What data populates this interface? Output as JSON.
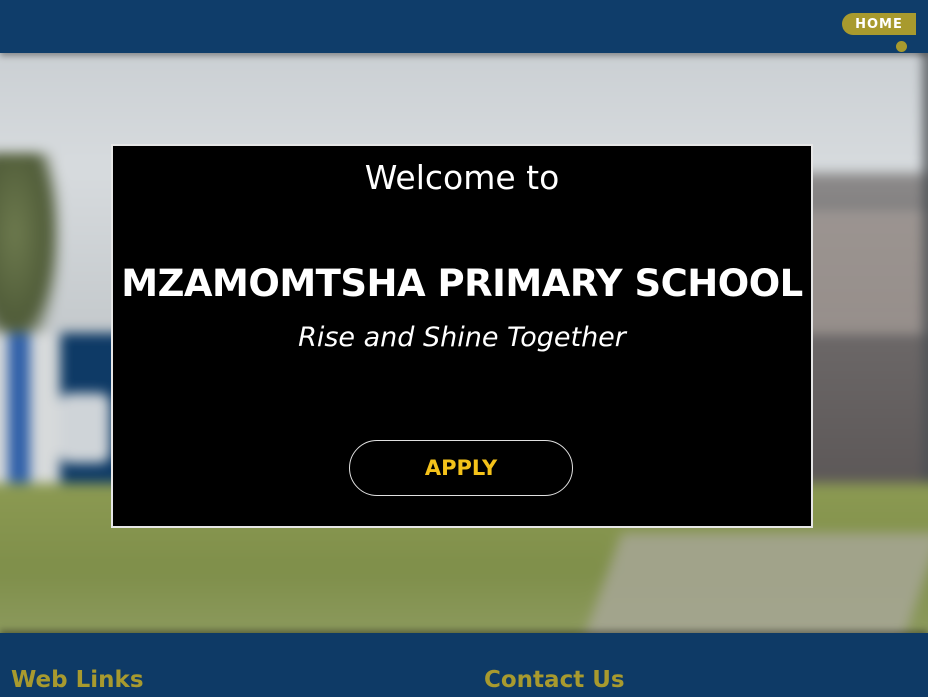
{
  "header": {
    "nav": {
      "home_label": "HOME"
    }
  },
  "hero": {
    "welcome": "Welcome to",
    "school_name": "MZAMOMTSHA PRIMARY SCHOOL",
    "tagline": "Rise and Shine Together",
    "apply_label": "APPLY"
  },
  "footer": {
    "web_links_heading": "Web Links",
    "contact_heading": "Contact Us"
  },
  "colors": {
    "header_bg": "#0f3d6a",
    "accent_olive": "#a89a2e",
    "apply_text": "#f4c21a",
    "panel_bg": "#000000"
  }
}
